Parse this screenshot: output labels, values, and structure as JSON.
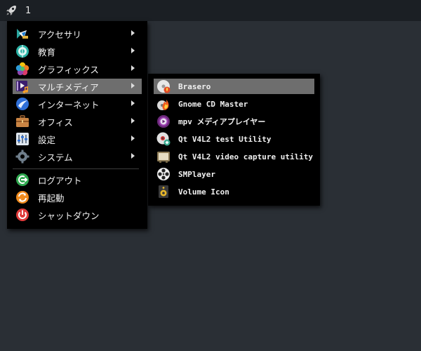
{
  "taskbar": {
    "launcher_icon": "rocket-icon",
    "workspace_label": "1"
  },
  "main_menu": {
    "items": [
      {
        "label": "アクセサリ",
        "icon": "accessories-icon",
        "has_submenu": true
      },
      {
        "label": "教育",
        "icon": "education-icon",
        "has_submenu": true
      },
      {
        "label": "グラフィックス",
        "icon": "graphics-icon",
        "has_submenu": true
      },
      {
        "label": "マルチメディア",
        "icon": "multimedia-icon",
        "has_submenu": true,
        "active": true
      },
      {
        "label": "インターネット",
        "icon": "internet-icon",
        "has_submenu": true
      },
      {
        "label": "オフィス",
        "icon": "office-icon",
        "has_submenu": true
      },
      {
        "label": "設定",
        "icon": "settings-icon",
        "has_submenu": true
      },
      {
        "label": "システム",
        "icon": "system-icon",
        "has_submenu": true
      }
    ],
    "session_items": [
      {
        "label": "ログアウト",
        "icon": "logout-icon"
      },
      {
        "label": "再起動",
        "icon": "reboot-icon"
      },
      {
        "label": "シャットダウン",
        "icon": "shutdown-icon"
      }
    ]
  },
  "sub_menu": {
    "items": [
      {
        "label": "Brasero",
        "icon": "brasero-icon",
        "active": true
      },
      {
        "label": "Gnome CD Master",
        "icon": "gnome-cd-master-icon"
      },
      {
        "label": "mpv メディアプレイヤー",
        "icon": "mpv-icon"
      },
      {
        "label": "Qt V4L2 test Utility",
        "icon": "qv4l2-icon"
      },
      {
        "label": "Qt V4L2 video capture utility",
        "icon": "qvidcap-icon"
      },
      {
        "label": "SMPlayer",
        "icon": "smplayer-icon"
      },
      {
        "label": "Volume Icon",
        "icon": "volume-icon"
      }
    ]
  },
  "colors": {
    "desktop_bg": "#2a2f35",
    "taskbar_bg": "#1b1f24",
    "menu_bg": "#000000",
    "highlight_bg": "#6e6e6e",
    "text": "#f0f0f0"
  }
}
